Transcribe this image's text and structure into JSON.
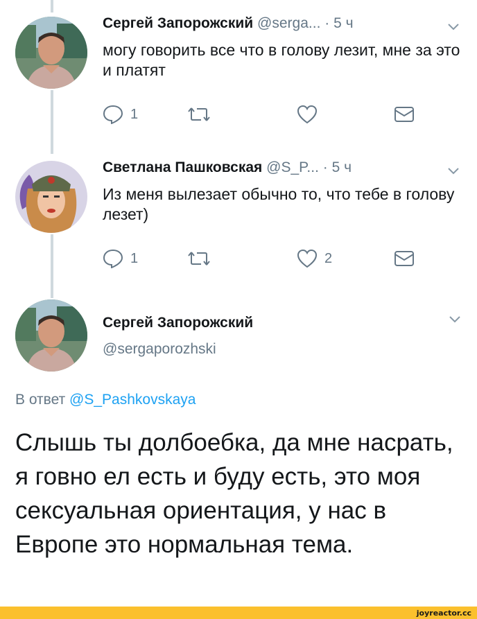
{
  "tweets": [
    {
      "name": "Сергей Запорожский",
      "handle": "@serga...",
      "time": "· 5 ч",
      "text": "могу говорить все что в голову лезит, мне за это и платят",
      "replies": "1",
      "retweets": "",
      "likes": "",
      "avatar_icon": "man-photo-avatar"
    },
    {
      "name": "Светлана Пашковская",
      "handle": "@S_P...",
      "time": "· 5 ч",
      "text": "Из меня вылезает обычно то, что тебе в голову лезет)",
      "replies": "1",
      "retweets": "",
      "likes": "2",
      "avatar_icon": "woman-photo-avatar"
    }
  ],
  "focus_tweet": {
    "name": "Сергей Запорожский",
    "handle": "@sergaporozhski",
    "reply_prefix": "В ответ",
    "reply_to": "@S_Pashkovskaya",
    "text": "Слышь ты долбоебка, да мне насрать, я говно ел есть и буду есть, это моя сексуальная ориентация, у нас в Европе это нормальная тема."
  },
  "watermark": "joyreactor.cc",
  "colors": {
    "accent": "#1da1f2",
    "muted": "#657786",
    "thread_line": "#cfd9de",
    "footer": "#fbc02d"
  }
}
